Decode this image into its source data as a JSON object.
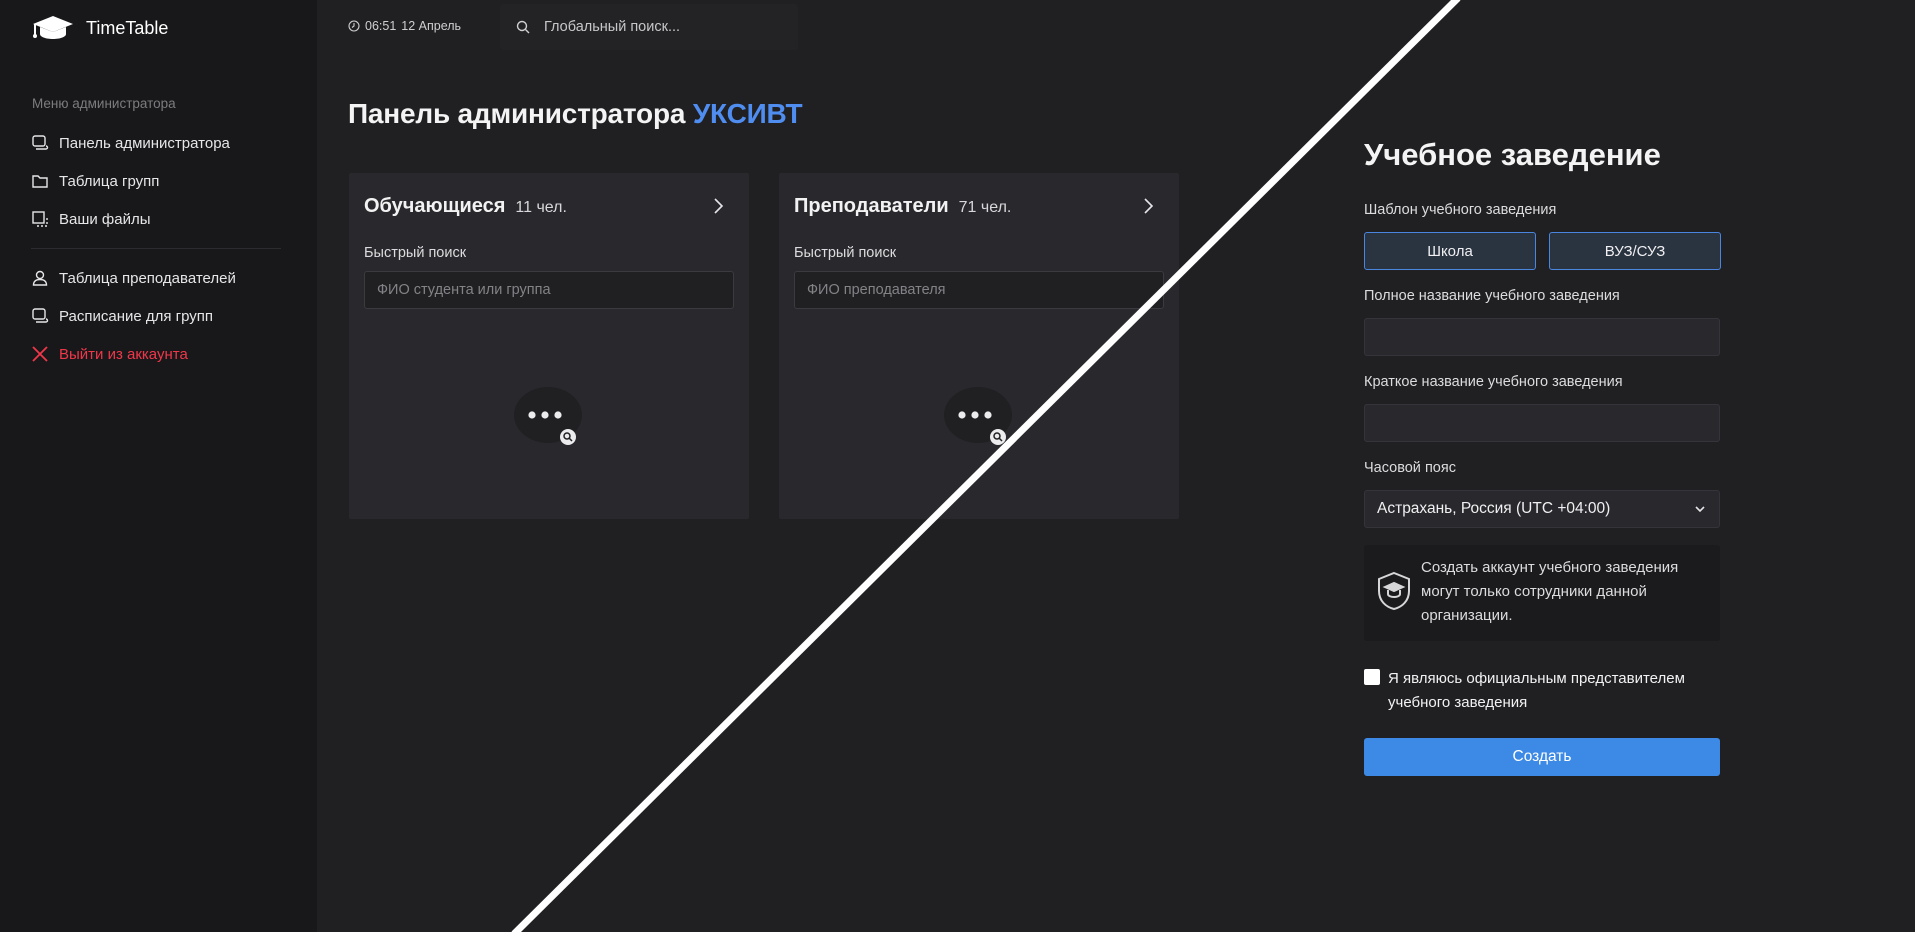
{
  "app": {
    "name": "TimeTable"
  },
  "sidebar": {
    "caption": "Меню администратора",
    "items": [
      {
        "label": "Панель администратора",
        "icon": "panel-icon"
      },
      {
        "label": "Таблица групп",
        "icon": "folder-icon"
      },
      {
        "label": "Ваши файлы",
        "icon": "files-icon"
      },
      {
        "label": "Таблица преподавателей",
        "icon": "user-icon"
      },
      {
        "label": "Расписание для групп",
        "icon": "schedule-icon"
      },
      {
        "label": "Выйти из аккаунта",
        "icon": "close-icon",
        "color": "#f0374a"
      }
    ]
  },
  "topbar": {
    "time": "06:51",
    "date": "12 Апрель",
    "search_placeholder": "Глобальный поиск..."
  },
  "page": {
    "title": "Панель администратора",
    "title_accent": "УКСИВТ",
    "accent_color": "#4f8ef0"
  },
  "cards": [
    {
      "title": "Обучающиеся",
      "count": "11 чел.",
      "search_label": "Быстрый поиск",
      "search_placeholder": "ФИО студента или группа"
    },
    {
      "title": "Преподаватели",
      "count": "71 чел.",
      "search_label": "Быстрый поиск",
      "search_placeholder": "ФИО преподавателя"
    }
  ],
  "form": {
    "title": "Учебное заведение",
    "template_label": "Шаблон учебного заведения",
    "template_options": [
      "Школа",
      "ВУЗ/СУЗ"
    ],
    "full_name_label": "Полное название учебного заведения",
    "full_name_value": "",
    "short_name_label": "Краткое название учебного заведения",
    "short_name_value": "",
    "timezone_label": "Часовой пояс",
    "timezone_value": "Астрахань, Россия (UTC +04:00)",
    "notice": "Создать аккаунт учебного заведения могут только сотрудники данной организации.",
    "checkbox_label": "Я являюсь официальным представителем учебного заведения",
    "submit_label": "Создать",
    "submit_color": "#3d8ae6"
  }
}
